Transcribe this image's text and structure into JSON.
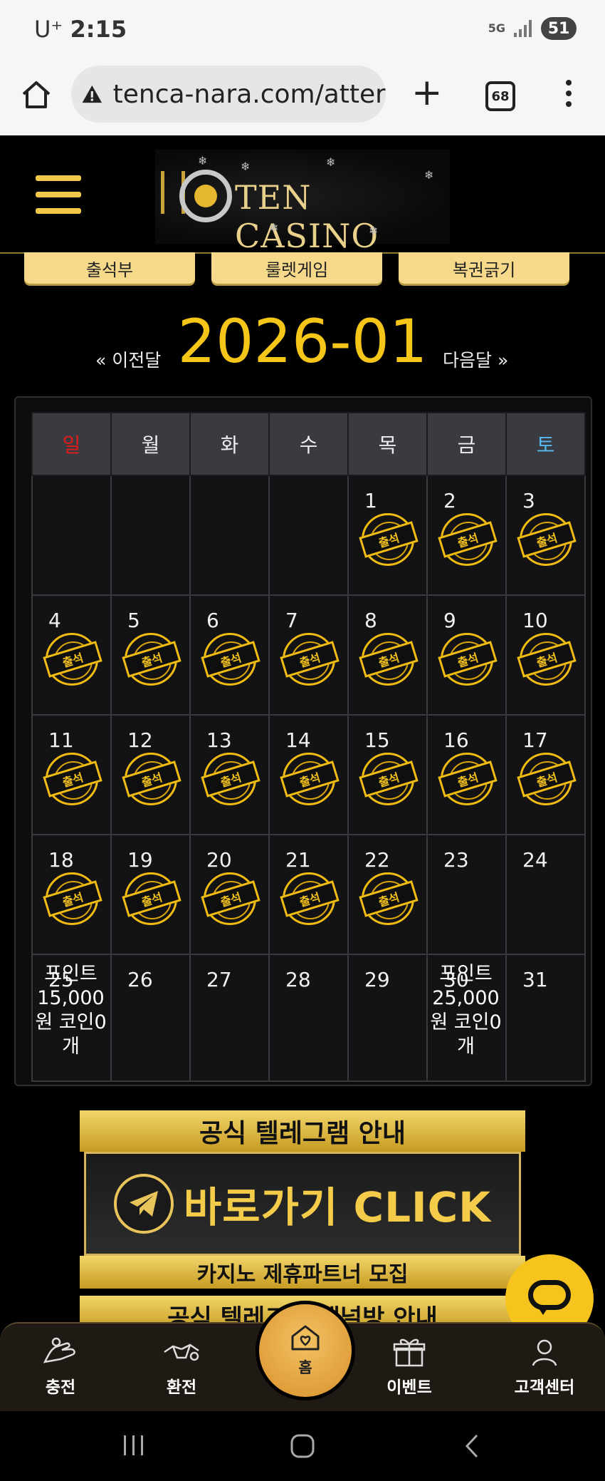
{
  "status_bar": {
    "carrier": "U⁺",
    "time": "2:15",
    "network": "5G",
    "battery": "51"
  },
  "browser": {
    "url": "tenca-nara.com/atter",
    "tab_count": "68"
  },
  "site": {
    "logo_text": "TEN CASINO"
  },
  "top_buttons": [
    "출석부",
    "룰렛게임",
    "복권긁기"
  ],
  "calendar": {
    "month_label": "2026-01",
    "prev_label": "« 이전달",
    "next_label": "다음달 »",
    "weekdays": [
      "일",
      "월",
      "화",
      "수",
      "목",
      "금",
      "토"
    ],
    "stamp_label": "출석",
    "weeks": [
      [
        {
          "day": ""
        },
        {
          "day": ""
        },
        {
          "day": ""
        },
        {
          "day": ""
        },
        {
          "day": "1",
          "stamp": true
        },
        {
          "day": "2",
          "stamp": true
        },
        {
          "day": "3",
          "stamp": true
        }
      ],
      [
        {
          "day": "4",
          "stamp": true
        },
        {
          "day": "5",
          "stamp": true
        },
        {
          "day": "6",
          "stamp": true
        },
        {
          "day": "7",
          "stamp": true
        },
        {
          "day": "8",
          "stamp": true
        },
        {
          "day": "9",
          "stamp": true
        },
        {
          "day": "10",
          "stamp": true
        }
      ],
      [
        {
          "day": "11",
          "stamp": true
        },
        {
          "day": "12",
          "stamp": true
        },
        {
          "day": "13",
          "stamp": true
        },
        {
          "day": "14",
          "stamp": true
        },
        {
          "day": "15",
          "stamp": true
        },
        {
          "day": "16",
          "stamp": true
        },
        {
          "day": "17",
          "stamp": true
        }
      ],
      [
        {
          "day": "18",
          "stamp": true
        },
        {
          "day": "19",
          "stamp": true
        },
        {
          "day": "20",
          "stamp": true
        },
        {
          "day": "21",
          "stamp": true
        },
        {
          "day": "22",
          "stamp": true
        },
        {
          "day": "23"
        },
        {
          "day": "24"
        }
      ],
      [
        {
          "day": "25",
          "reward": "포인트 15,000 원 코인0 개"
        },
        {
          "day": "26"
        },
        {
          "day": "27"
        },
        {
          "day": "28"
        },
        {
          "day": "29"
        },
        {
          "day": "30",
          "reward": "포인트 25,000 원 코인0 개"
        },
        {
          "day": "31"
        }
      ]
    ]
  },
  "banner": {
    "title": "공식 텔레그램 안내",
    "cta": "바로가기 CLICK",
    "subtitle": "카지노 제휴파트너 모집",
    "next_title_cut": "공식 텔레그램 채널방 안내"
  },
  "bottom_nav": {
    "charge": "충전",
    "exchange": "환전",
    "home": "홈",
    "event": "이벤트",
    "support": "고객센터"
  },
  "colors": {
    "accent": "#f5c518",
    "sunday": "#e21b1b",
    "saturday": "#57b9f2"
  }
}
